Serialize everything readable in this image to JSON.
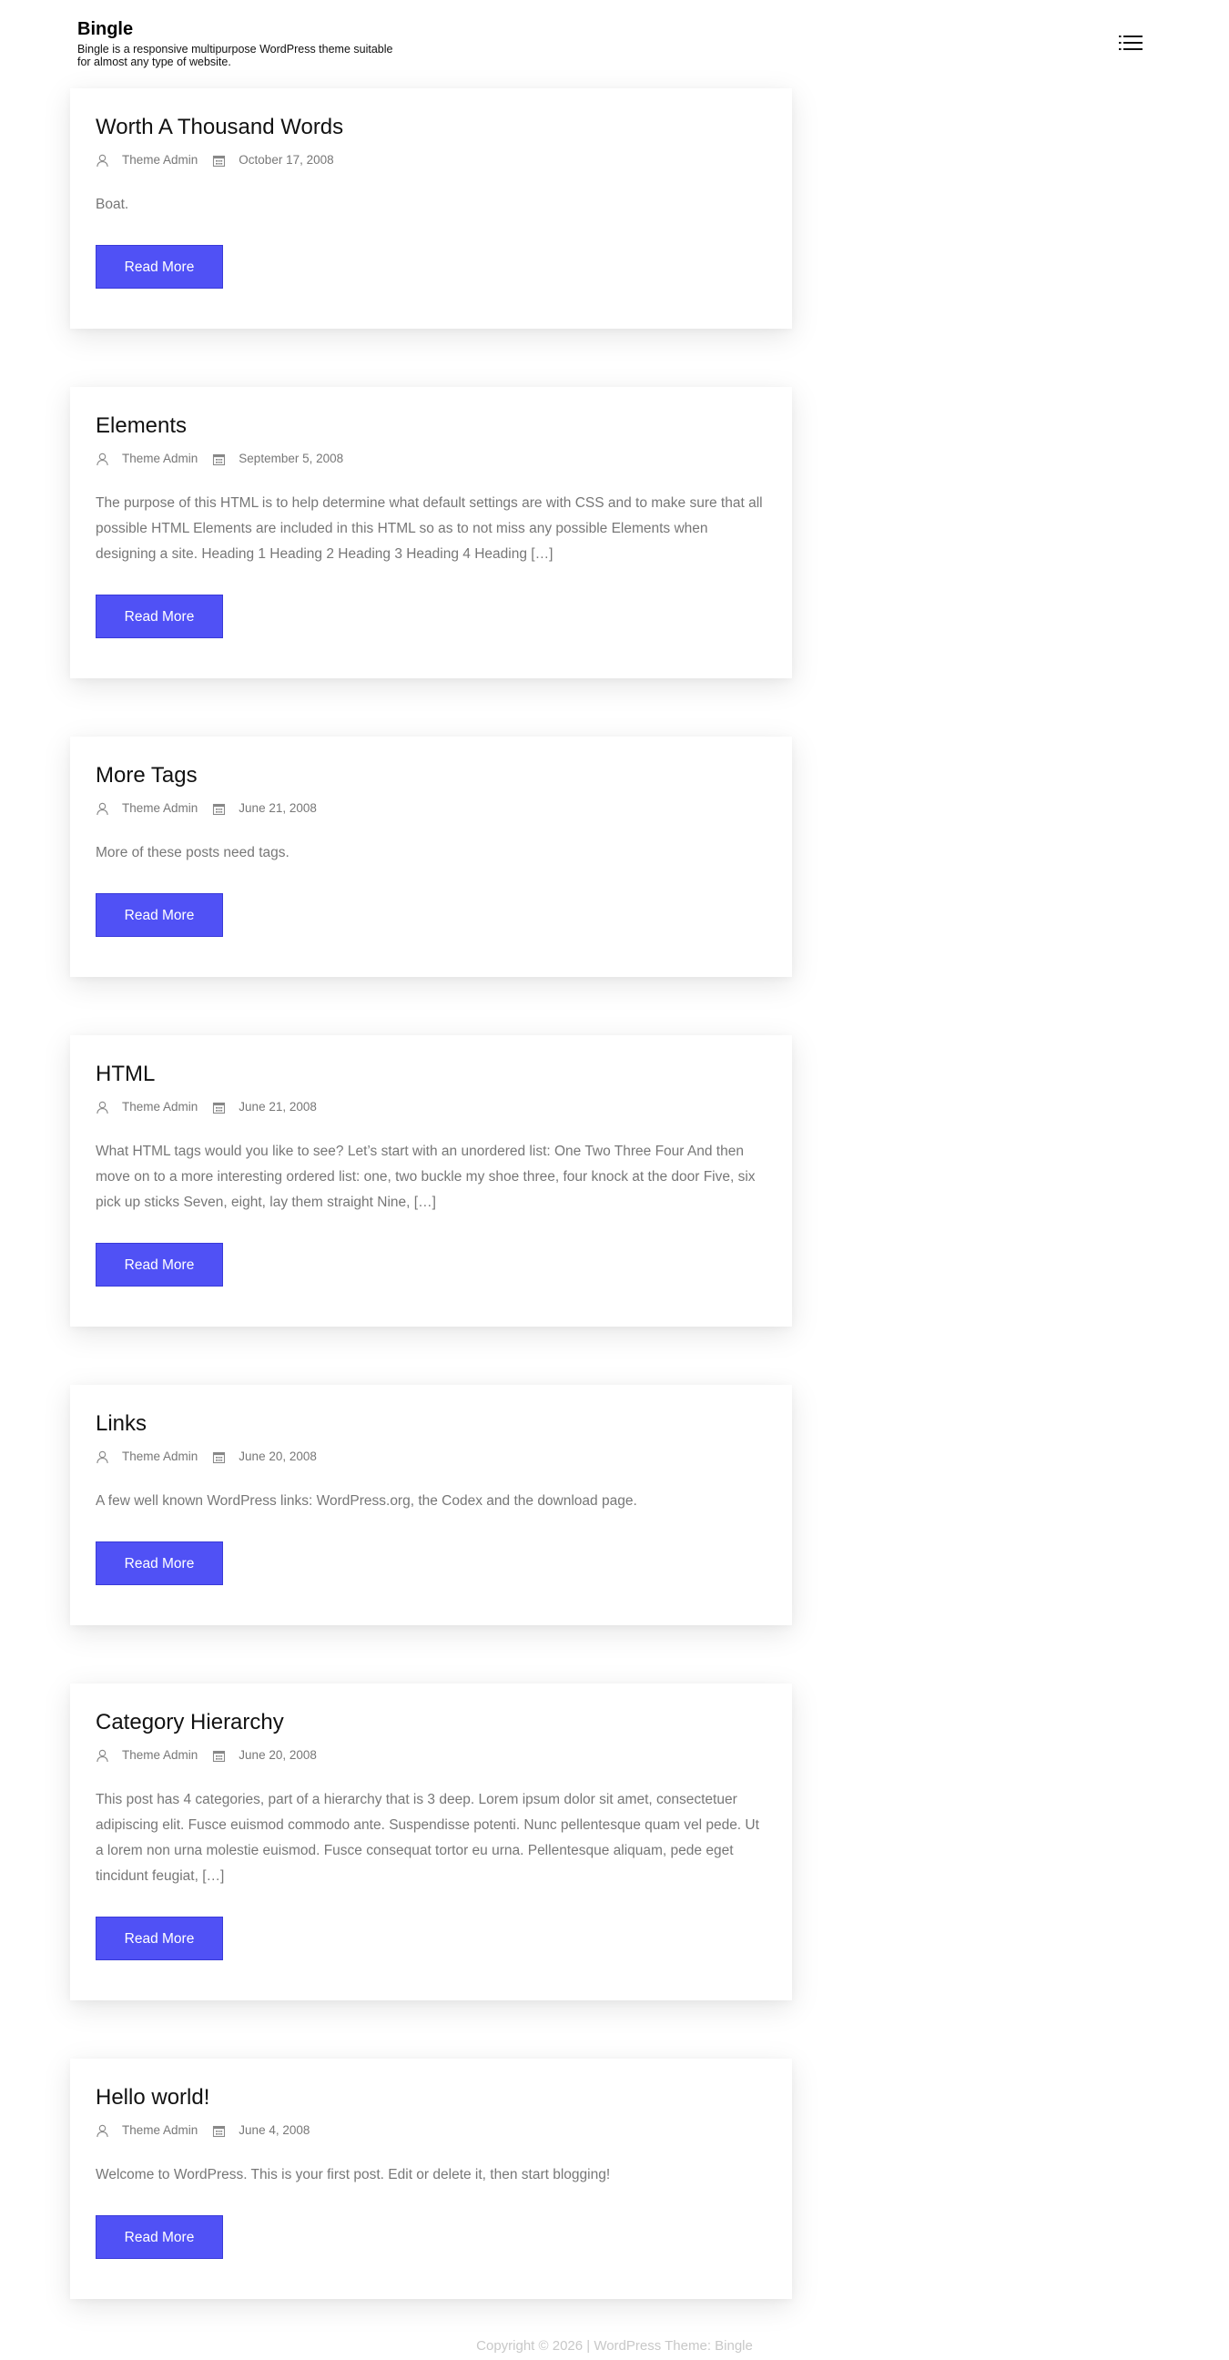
{
  "site": {
    "title": "Bingle",
    "description": "Bingle is a responsive multipurpose WordPress theme suitable for almost any type of website."
  },
  "header": {
    "menu_icon": "menu-list-icon"
  },
  "posts": [
    {
      "title": "Worth A Thousand Words",
      "author": "Theme Admin",
      "date": "October 17, 2008",
      "excerpt": "Boat.",
      "read_more": "Read More"
    },
    {
      "title": "Elements",
      "author": "Theme Admin",
      "date": "September 5, 2008",
      "excerpt": "The purpose of this HTML is to help determine what default settings are with CSS and to make sure that all possible HTML Elements are included in this HTML so as to not miss any possible Elements when designing a site. Heading 1 Heading 2 Heading 3 Heading 4 Heading […]",
      "read_more": "Read More"
    },
    {
      "title": "More Tags",
      "author": "Theme Admin",
      "date": "June 21, 2008",
      "excerpt": "More of these posts need tags.",
      "read_more": "Read More"
    },
    {
      "title": "HTML",
      "author": "Theme Admin",
      "date": "June 21, 2008",
      "excerpt": "What HTML tags would you like to see? Let’s start with an unordered list: One Two Three Four And then move on to a more interesting ordered list: one, two buckle my shoe three, four knock at the door Five, six pick up sticks Seven, eight, lay them straight Nine, […]",
      "read_more": "Read More"
    },
    {
      "title": "Links",
      "author": "Theme Admin",
      "date": "June 20, 2008",
      "excerpt": "A few well known WordPress links: WordPress.org, the Codex and the download page.",
      "read_more": "Read More"
    },
    {
      "title": "Category Hierarchy",
      "author": "Theme Admin",
      "date": "June 20, 2008",
      "excerpt": "This post has 4 categories, part of a hierarchy that is 3 deep. Lorem ipsum dolor sit amet, consectetuer adipiscing elit. Fusce euismod commodo ante. Suspendisse potenti. Nunc pellentesque quam vel pede. Ut a lorem non urna molestie euismod. Fusce consequat tortor eu urna. Pellentesque aliquam, pede eget tincidunt feugiat, […]",
      "read_more": "Read More"
    },
    {
      "title": "Hello world!",
      "author": "Theme Admin",
      "date": "June 4, 2008",
      "excerpt": "Welcome to WordPress. This is your first post. Edit or delete it, then start blogging!",
      "read_more": "Read More"
    }
  ],
  "icons": {
    "author": "user-icon",
    "date": "calendar-icon"
  },
  "colors": {
    "button": "#5051f5",
    "meta_text": "#777777",
    "footer_text": "#c8c8c8"
  },
  "footer": {
    "text": "Copyright © 2026 | WordPress Theme: Bingle"
  }
}
